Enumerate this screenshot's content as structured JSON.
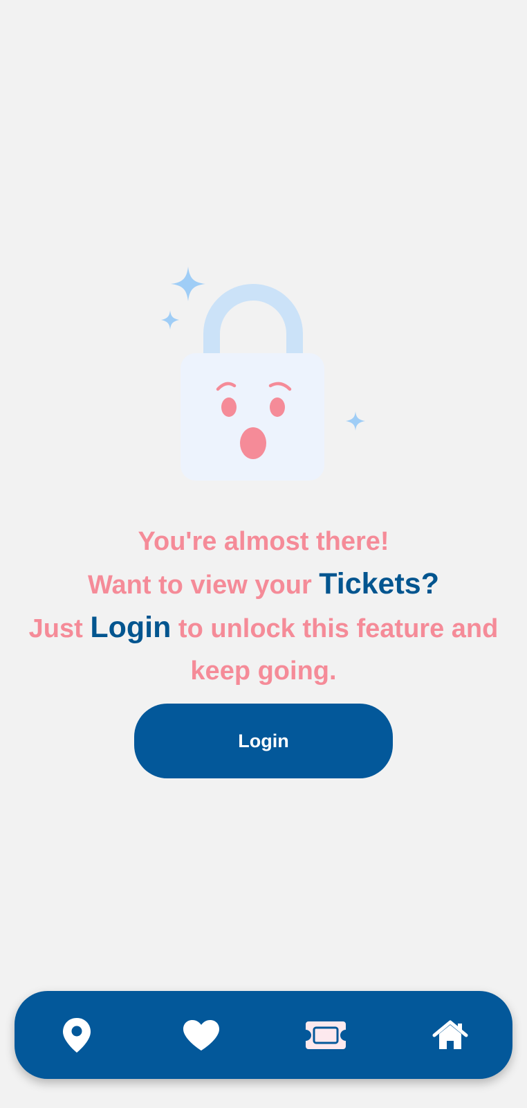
{
  "colors": {
    "background": "#f2f2f2",
    "accent_pink": "#f58b98",
    "brand_blue": "#03589a",
    "keyword_blue": "#03558f"
  },
  "message": {
    "line1": "You're almost there!",
    "line2_prefix": "Want to view your ",
    "line2_keyword": "Tickets?",
    "line3_prefix": "Just ",
    "line3_keyword": "Login",
    "line3_suffix": " to unlock this feature and keep going."
  },
  "login_button": {
    "label": "Login"
  },
  "bottom_nav": {
    "items": [
      {
        "icon": "location-pin-icon"
      },
      {
        "icon": "heart-icon"
      },
      {
        "icon": "ticket-icon"
      },
      {
        "icon": "home-icon"
      }
    ]
  }
}
